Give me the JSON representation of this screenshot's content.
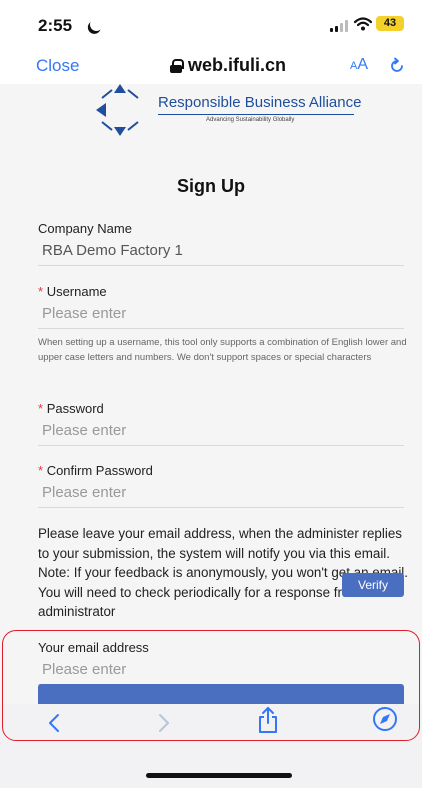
{
  "status": {
    "time": "2:55",
    "battery": "43"
  },
  "nav": {
    "close": "Close",
    "url": "web.ifuli.cn",
    "aa_small": "A",
    "aa_large": "A"
  },
  "logo": {
    "title": "Responsible Business Alliance",
    "subtitle": "Advancing Sustainability Globally"
  },
  "form": {
    "title": "Sign Up",
    "company_label": "Company Name",
    "company_value": "RBA Demo Factory 1",
    "username_label": "Username",
    "username_placeholder": "Please enter",
    "username_hint": "When setting up a username, this tool only supports a combination of English lower and upper case letters and numbers. We don't support spaces or special characters",
    "password_label": "Password",
    "password_placeholder": "Please enter",
    "confirm_label": "Confirm Password",
    "confirm_placeholder": "Please enter",
    "email_note": "Please leave your email address, when the administer replies to your submission, the system will notify you via this email. Note: If your feedback is anonymously, you won't get an email. You will need to check periodically for a response from the administrator",
    "email_label": "Your email address",
    "email_placeholder": "Please enter",
    "verify_label": "Verify",
    "required_mark": "*"
  },
  "colors": {
    "accent": "#3478f6",
    "button": "#4a6fc0",
    "required": "#e23b3b",
    "highlight": "#e01e2b",
    "brand": "#1f4e9c"
  },
  "icons": [
    "moon-icon",
    "signal-icon",
    "wifi-icon",
    "battery-icon",
    "lock-icon",
    "reload-icon",
    "back-icon",
    "forward-icon",
    "share-icon",
    "compass-icon"
  ]
}
